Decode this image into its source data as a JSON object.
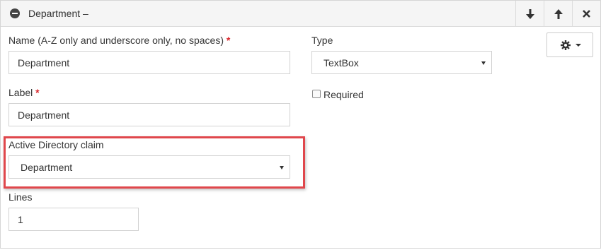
{
  "header": {
    "title": "Department –",
    "buttons": {
      "move_down": "arrow-down-icon",
      "move_up": "arrow-up-icon",
      "remove": "close-icon"
    }
  },
  "form": {
    "name": {
      "label": "Name (A-Z only and underscore only, no spaces)",
      "required_mark": "*",
      "value": "Department"
    },
    "label": {
      "label": "Label",
      "required_mark": "*",
      "value": "Department"
    },
    "ad_claim": {
      "label": "Active Directory claim",
      "value": "Department"
    },
    "lines": {
      "label": "Lines",
      "value": "1"
    },
    "type": {
      "label": "Type",
      "value": "TextBox"
    },
    "required": {
      "label": "Required",
      "checked": false
    },
    "settings_button": {
      "icon": "gear-icon"
    }
  },
  "colors": {
    "required_mark": "#d9262b",
    "highlight_border": "#e0474c",
    "header_bg": "#f5f5f5"
  }
}
